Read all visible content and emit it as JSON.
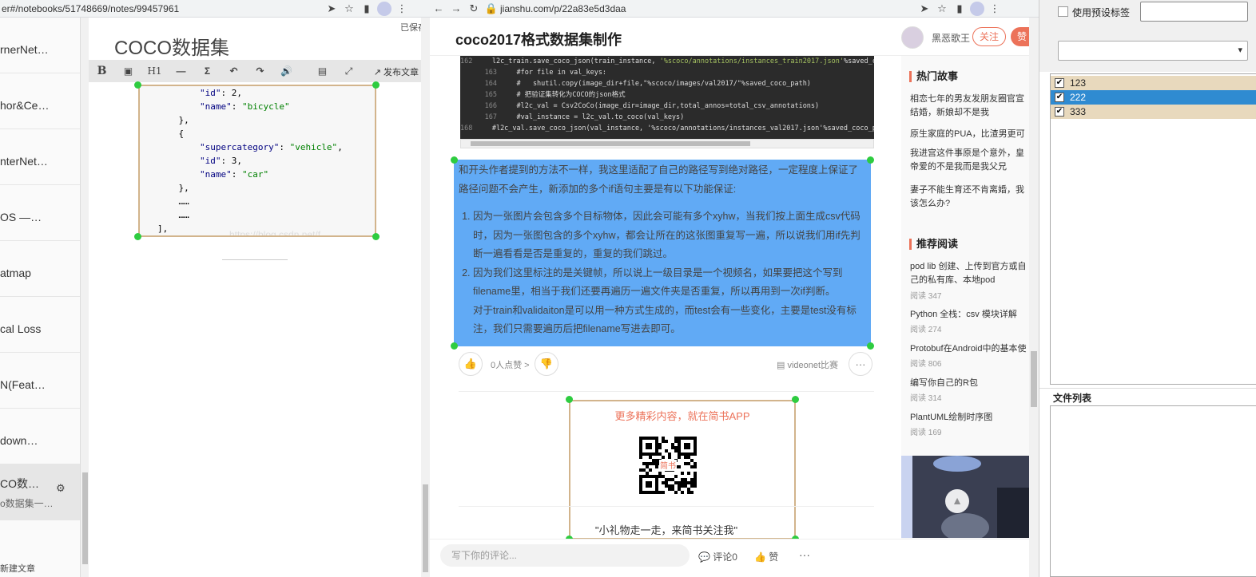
{
  "left_window": {
    "url": "er#/notebooks/51748669/notes/99457961",
    "notes": [
      {
        "title": "rnerNet…"
      },
      {
        "title": "hor&Ce…"
      },
      {
        "title": "nterNet…"
      },
      {
        "title": "OS —…"
      },
      {
        "title": "atmap"
      },
      {
        "title": "cal Loss"
      },
      {
        "title": "N(Feat…"
      },
      {
        "title": "down…"
      },
      {
        "title": "CO数…",
        "subtitle": "o数据集一…",
        "active": true
      }
    ],
    "new_article": "新建文章",
    "editor": {
      "title": "COCO数据集",
      "saved_label": "已保存",
      "publish_label": "发布文章",
      "toolbar": [
        "B",
        "img",
        "H1",
        "—",
        "Σ",
        "undo",
        "redo",
        "audio",
        "save",
        "fullscreen"
      ],
      "code_lines": [
        {
          "indent": "        ",
          "key": "\"id\"",
          "sep": ": ",
          "val": "2,"
        },
        {
          "indent": "        ",
          "key": "\"name\"",
          "sep": ": ",
          "str": "\"bicycle\""
        },
        {
          "indent": "    ",
          "raw": "},"
        },
        {
          "indent": "    ",
          "raw": "{"
        },
        {
          "indent": "        ",
          "key": "\"supercategory\"",
          "sep": ": ",
          "str": "\"vehicle\"",
          "tail": ","
        },
        {
          "indent": "        ",
          "key": "\"id\"",
          "sep": ": ",
          "val": "3,"
        },
        {
          "indent": "        ",
          "key": "\"name\"",
          "sep": ": ",
          "str": "\"car\""
        },
        {
          "indent": "    ",
          "raw": "},"
        },
        {
          "indent": "    ",
          "raw": "……"
        },
        {
          "indent": "    ",
          "raw": "……"
        },
        {
          "indent": "",
          "raw": "],"
        }
      ],
      "watermark": "https://blog.csdn.net/f"
    }
  },
  "mid_window": {
    "url": "jianshu.com/p/22a83e5d3daa",
    "article_title": "coco2017格式数据集制作",
    "author": "黑恶歌王",
    "follow_label": "关注",
    "like_label": "赞",
    "code": [
      {
        "ln": "162",
        "code": "    l2c_train.save_coco_json(train_instance, ",
        "s": "'%scoco/annotations/instances_train2017.json'",
        "tail": "%saved_coco_pa"
      },
      {
        "ln": "163",
        "code": "    #for file in val_keys:",
        "comment": true
      },
      {
        "ln": "164",
        "code": "    #   shutil.copy(image_dir+file,\"%scoco/images/val2017/\"%saved_coco_path)",
        "comment": true
      },
      {
        "ln": "165",
        "code": "    # 把验证集转化为COCO的json格式",
        "comment": true
      },
      {
        "ln": "166",
        "code": "    #l2c_val = Csv2CoCo(image_dir=image_dir,total_annos=total_csv_annotations)",
        "comment": true
      },
      {
        "ln": "167",
        "code": "    #val_instance = l2c_val.to_coco(val_keys)",
        "comment": true
      },
      {
        "ln": "168",
        "code": "    #l2c_val.save_coco_json(val_instance, '%scoco/annotations/instances_val2017.json'%saved_coco_path)",
        "comment": true
      }
    ],
    "selected_paragraph": "和开头作者提到的方法不一样，我这里适配了自己的路径写到绝对路径，一定程度上保证了路径问题不会产生，新添加的多个if语句主要是有以下功能保证:",
    "selected_list": [
      "因为一张图片会包含多个目标物体，因此会可能有多个xyhw，当我们按上面生成csv代码时，因为一张图包含的多个xyhw，都会让所在的这张图重复写一遍，所以说我们用if先判断一遍看看是否是重复的，重复的我们跳过。",
      "因为我们这里标注的是关键帧，所以说上一级目录是一个视频名，如果要把这个写到filename里，相当于我们还要再遍历一遍文件夹是否重复，所以再用到一次if判断。\n对于train和validaiton是可以用一种方式生成的，而test会有一些变化，主要是test没有标注，我们只需要遍历后把filename写进去即可。"
    ],
    "likes_text": "0人点赞 >",
    "collection": "videonet比赛",
    "promo_title": "更多精彩内容，就在简书APP",
    "qr_center": "简书",
    "gift_text": "\"小礼物走一走，来简书关注我\"",
    "hot_title": "热门故事",
    "hot_items": [
      "相恋七年的男友发朋友圈官宣结婚，新娘却不是我",
      "原生家庭的PUA，比渣男更可怕",
      "我进宫这件事原是个意外，皇帝爱的不是我而是我父兄",
      "妻子不能生育还不肯离婚，我该怎么办?"
    ],
    "rec_title": "推荐阅读",
    "rec_items": [
      {
        "title": "pod lib 创建、上传到官方或自己的私有库、本地pod",
        "reads": "阅读 347"
      },
      {
        "title": "Python 全栈：csv 模块详解",
        "reads": "阅读 274"
      },
      {
        "title": "Protobuf在Android中的基本使用",
        "reads": "阅读 806"
      },
      {
        "title": "编写你自己的R包",
        "reads": "阅读 314"
      },
      {
        "title": "PlantUML绘制时序图",
        "reads": "阅读 169"
      }
    ],
    "comment_placeholder": "写下你的评论...",
    "comment_count": "评论0",
    "zan": "赞",
    "more": "···"
  },
  "right_panel": {
    "preset_label": "使用预设标签",
    "tags": [
      {
        "label": "123",
        "checked": true,
        "selected": false
      },
      {
        "label": "222",
        "checked": true,
        "selected": true
      },
      {
        "label": "333",
        "checked": true,
        "selected": false
      }
    ],
    "filelist_title": "文件列表"
  },
  "colors": {
    "accent": "#ec7259",
    "selection": "#61aaf5",
    "tag_selected": "#2f8bd1",
    "tag_row": "#e8d9bd",
    "handle": "#2ecc40"
  }
}
